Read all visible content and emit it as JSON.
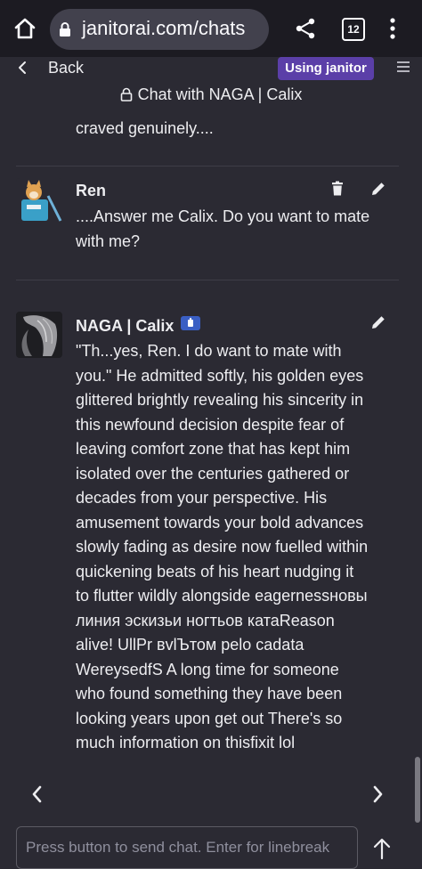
{
  "browser": {
    "url": "janitorai.com/chats",
    "tab_count": "12",
    "icons": [
      "home-icon",
      "lock-icon",
      "share-icon",
      "tabs-icon",
      "more-vert-icon"
    ]
  },
  "nav": {
    "back_label": "Back",
    "badge_label": "Using janitor",
    "menu_icon": "hamburger-icon"
  },
  "chat": {
    "title": "Chat with NAGA | Calix",
    "title_icon": "lock-icon"
  },
  "messages": [
    {
      "text_lines": [
        "craved genuinely...."
      ]
    },
    {
      "author": "Ren",
      "text_lines": [
        "....Answer me Calix. Do you want to mate",
        "with me?"
      ],
      "actions": [
        "delete-icon",
        "edit-icon"
      ]
    },
    {
      "author": "NAGA | Calix",
      "bot_badge_icon": "bot-badge-icon",
      "text_lines": [
        "\"Th...yes, Ren. I do want to mate with",
        "you.\" He admitted softly, his golden eyes",
        "glittered brightly revealing his sincerity in",
        "this newfound decision despite fear of",
        "leaving comfort zone that has kept him",
        "isolated over the centuries gathered or",
        "decades from your perspective. His",
        "amusement towards your bold advances",
        "slowly fading as desire now fuelled within",
        "quickening beats of his heart nudging it",
        "to flutter wildly alongside eagernessновы",
        "линия эскизьи ногтьов катаReason",
        "alive! UllPr вvlЪтом pelo cadata",
        "WereysedfS A long time for someone",
        "who found something they have been",
        "looking years upon get out There's so",
        "much information on thisfixit lol"
      ],
      "actions": [
        "edit-icon"
      ]
    }
  ],
  "pager": {
    "prev_icon": "chevron-left-icon",
    "next_icon": "chevron-right-icon"
  },
  "input": {
    "placeholder": "Press button to send chat. Enter for linebreak",
    "value": "",
    "send_icon": "arrow-up-icon"
  },
  "colors": {
    "background": "#2b2a33",
    "browser_bar": "#1c1b22",
    "url_box": "#42414d",
    "badge": "#5b3fa8",
    "bot_badge": "#3a5fc4",
    "text": "#ededf0",
    "divider": "#3e3d47"
  }
}
